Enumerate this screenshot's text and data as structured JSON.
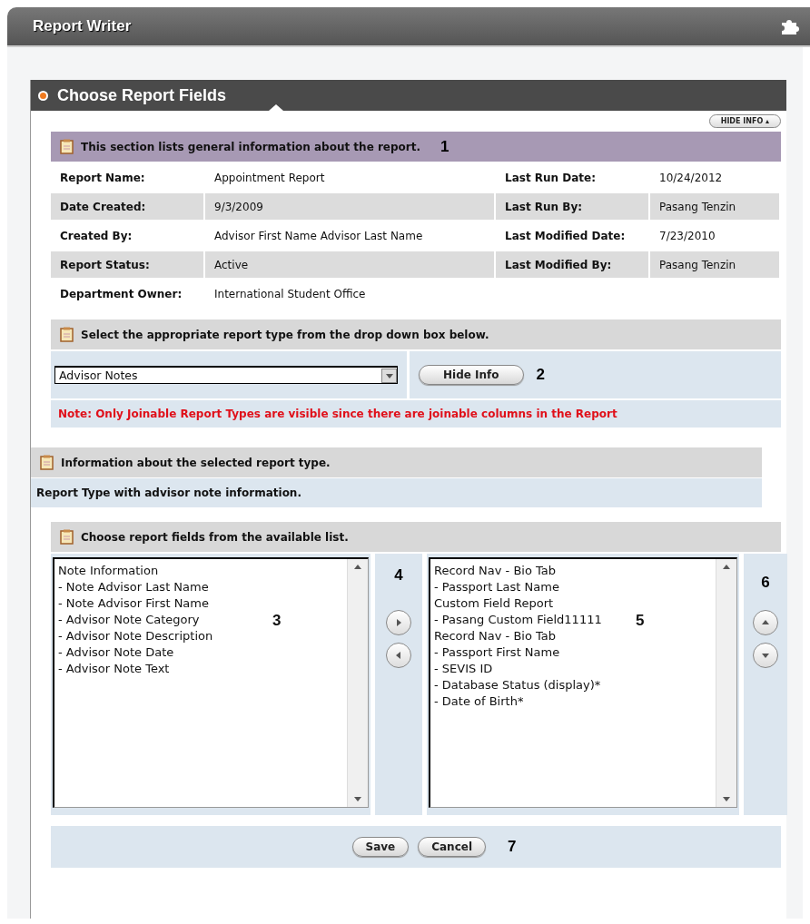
{
  "window": {
    "title": "Report Writer"
  },
  "panel": {
    "title": "Choose Report Fields",
    "hide_info": "HIDE INFO ▴"
  },
  "general": {
    "heading": "This section lists general information about the report.",
    "callout": "1",
    "rows": [
      {
        "label": "Report Name:",
        "value": "Appointment Report",
        "label_2": "Last Run Date:",
        "value_2": "10/24/2012"
      },
      {
        "label": "Date Created:",
        "value": "9/3/2009",
        "label_2": "Last Run By:",
        "value_2": "Pasang Tenzin"
      },
      {
        "label": "Created By:",
        "value": "Advisor First Name Advisor Last Name",
        "label_2": "Last Modified Date:",
        "value_2": "7/23/2010"
      },
      {
        "label": "Report Status:",
        "value": "Active",
        "label_2": "Last Modified By:",
        "value_2": "Pasang Tenzin"
      },
      {
        "label": "Department Owner:",
        "value": "International Student Office"
      }
    ]
  },
  "report_type": {
    "heading": "Select the appropriate report type from the drop down box below.",
    "value": "Advisor Notes",
    "button": "Hide Info",
    "callout": "2",
    "note": "Note: Only Joinable Report Types are visible since there are joinable columns in the Report"
  },
  "type_info": {
    "heading": "Information about the selected report type.",
    "text": "Report Type with advisor note information."
  },
  "fields": {
    "heading": "Choose report fields from the available list.",
    "available": [
      "Note Information",
      "- Note Advisor Last Name",
      "- Note Advisor First Name",
      "- Advisor Note Category",
      "- Advisor Note Description",
      "- Advisor Note Date",
      "- Advisor Note Text"
    ],
    "available_callout": "3",
    "move_callout": "4",
    "chosen": [
      "Record Nav - Bio Tab",
      "- Passport Last Name",
      "Custom Field Report",
      "- Pasang Custom Field11111",
      "Record Nav - Bio Tab",
      "- Passport First Name",
      "- SEVIS ID",
      "- Database Status (display)*",
      "- Date of Birth*"
    ],
    "chosen_callout": "5",
    "order_callout": "6"
  },
  "actions": {
    "buttons": [
      "Save",
      "Cancel"
    ],
    "callout": "7"
  }
}
